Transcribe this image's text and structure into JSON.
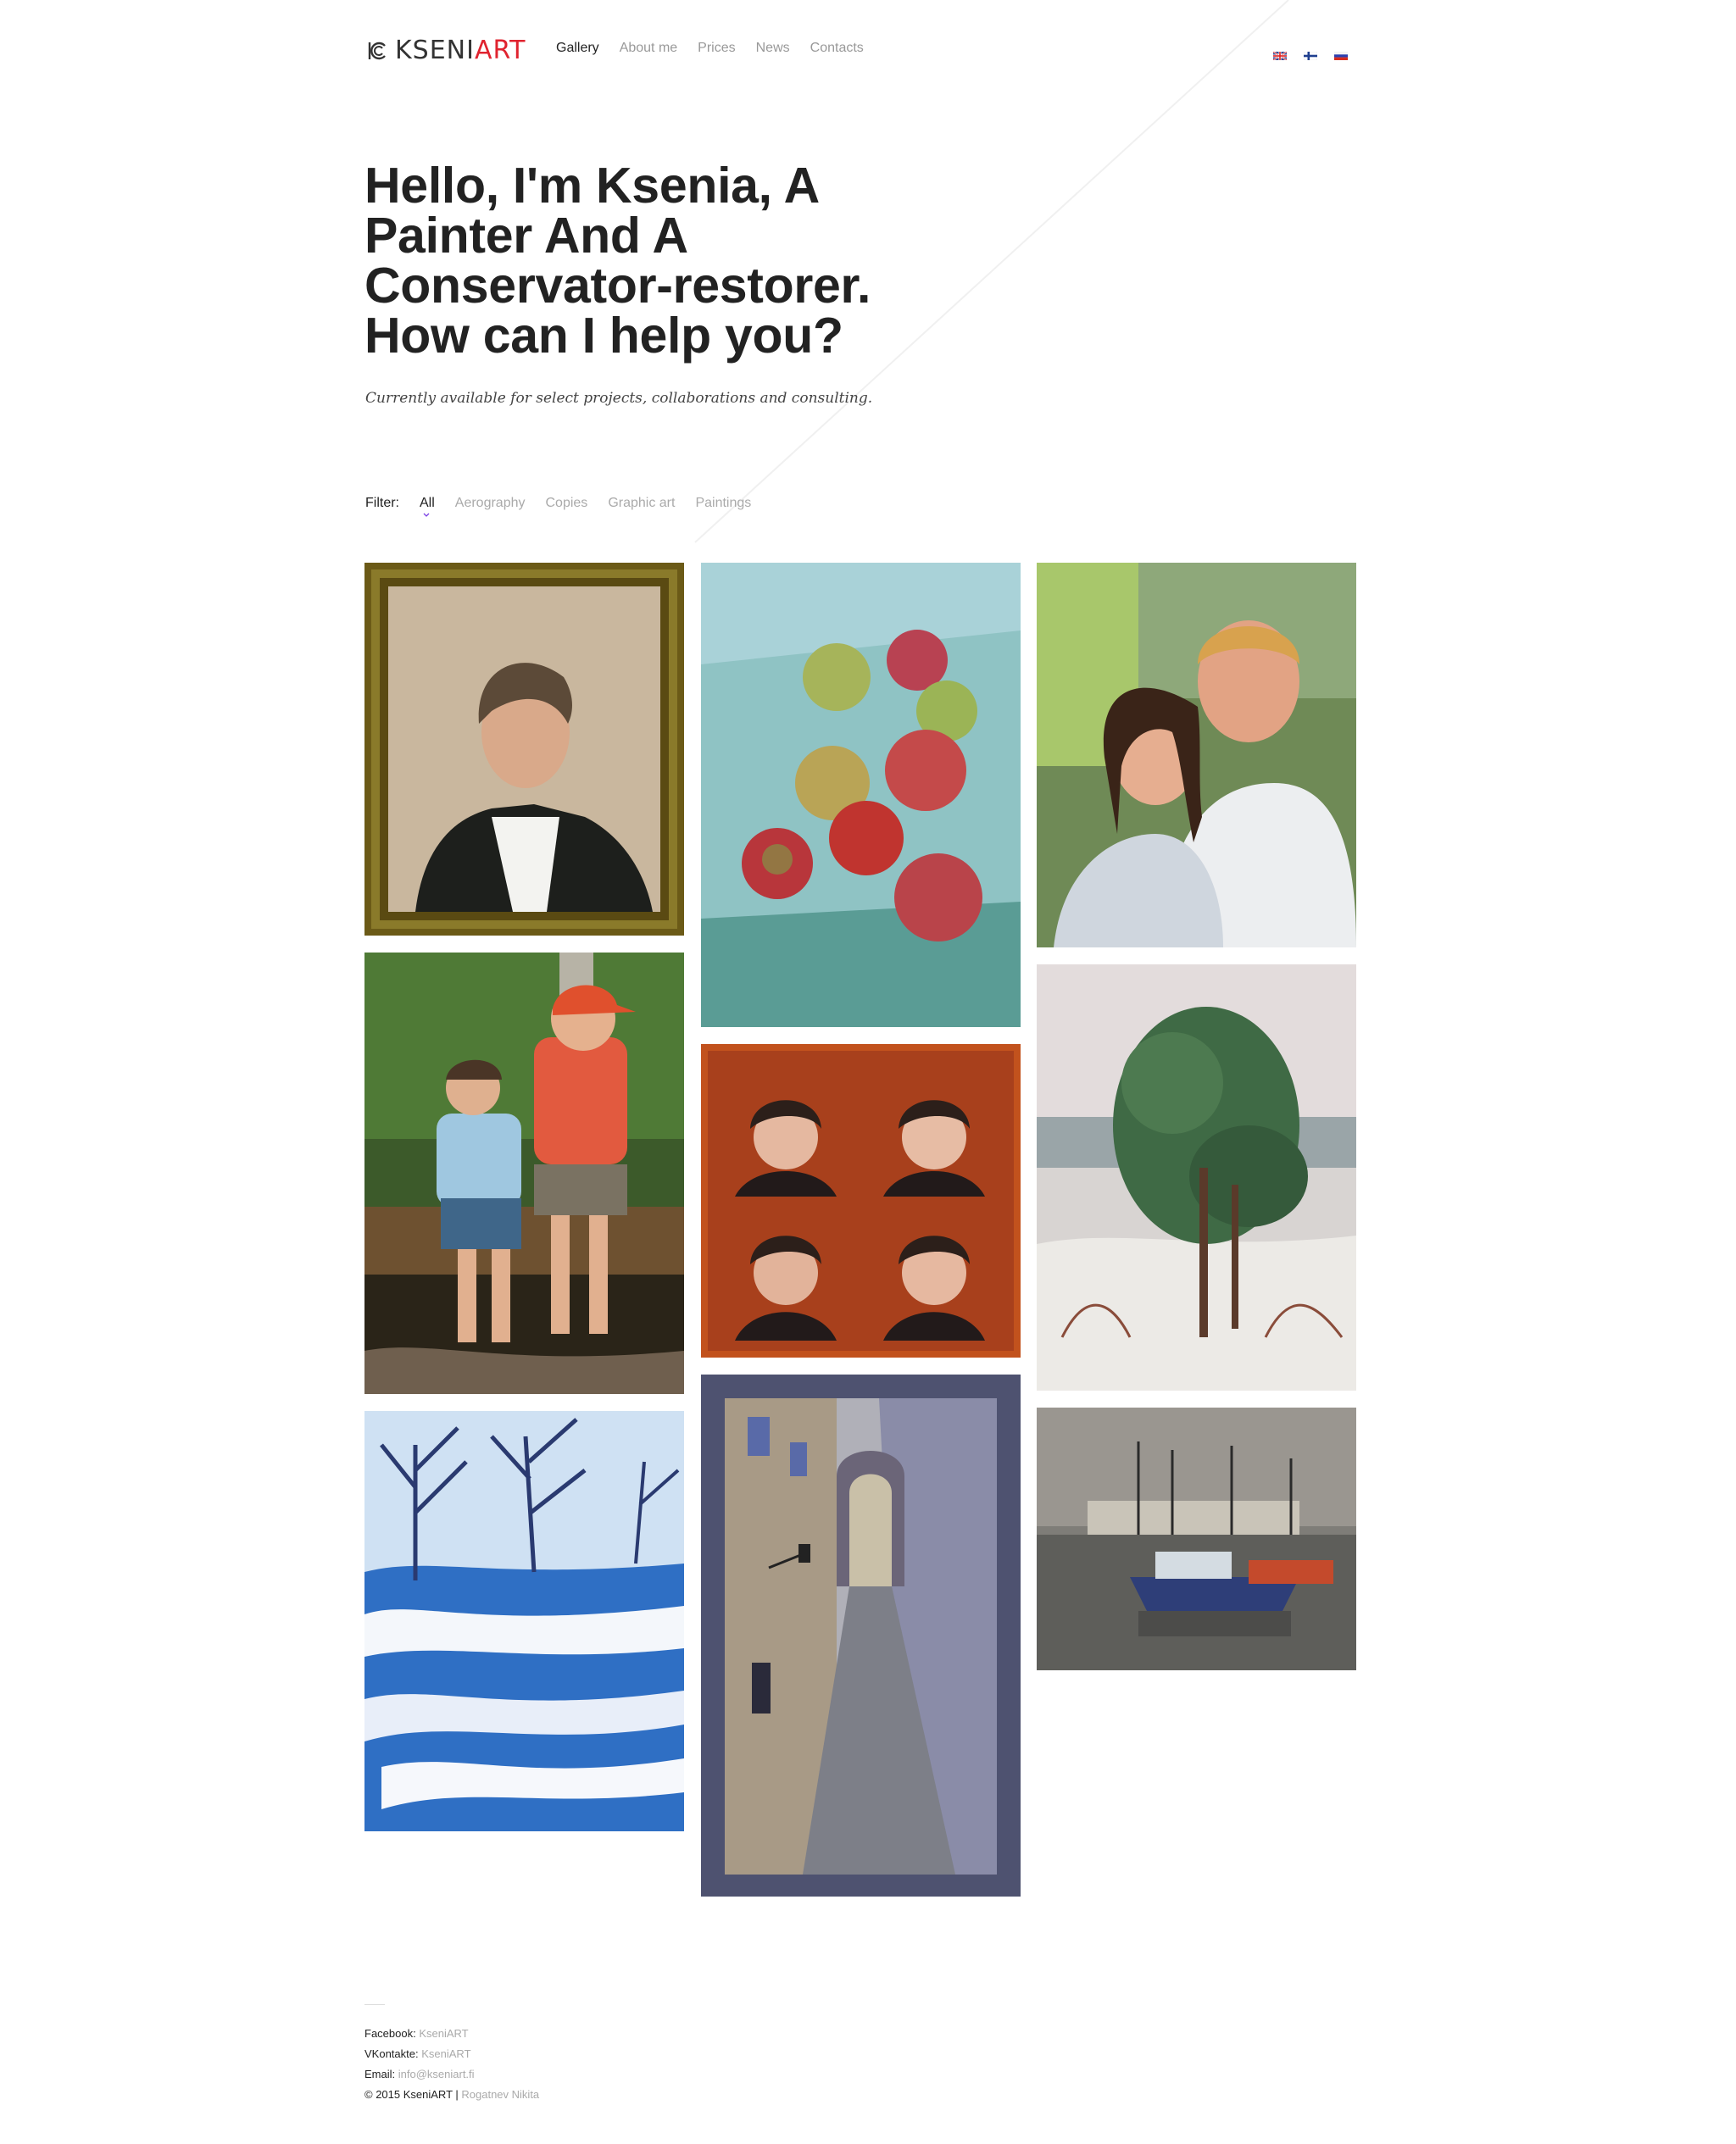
{
  "brand": {
    "logo_main": "KSENI",
    "logo_accent": "ART"
  },
  "nav": [
    {
      "label": "Gallery",
      "active": true
    },
    {
      "label": "About me"
    },
    {
      "label": "Prices"
    },
    {
      "label": "News"
    },
    {
      "label": "Contacts"
    }
  ],
  "languages": [
    "English",
    "Finnish",
    "Russian"
  ],
  "hero": {
    "title": "Hello, I'm Ksenia, A Painter And A Conservator-restorer. How can I help you?",
    "subtitle": "Currently available for select projects, collaborations and consulting."
  },
  "filter": {
    "label": "Filter:",
    "items": [
      "All",
      "Aerography",
      "Copies",
      "Graphic art",
      "Paintings"
    ],
    "active": "All"
  },
  "gallery": [
    {
      "subject": "framed portrait of a man in dark jacket"
    },
    {
      "subject": "apples still life"
    },
    {
      "subject": "portrait of a couple"
    },
    {
      "subject": "two boys on a pier"
    },
    {
      "subject": "four portraits of a woman"
    },
    {
      "subject": "pine tree in winter"
    },
    {
      "subject": "snowy winter landscape"
    },
    {
      "subject": "narrow old town street"
    },
    {
      "subject": "boats in harbor"
    }
  ],
  "footer": {
    "facebook_label": "Facebook:",
    "facebook_value": "KseniART",
    "vk_label": "VKontakte:",
    "vk_value": "KseniART",
    "email_label": "Email:",
    "email_value": "info@kseniart.fi",
    "copyright": "© 2015 KseniART |",
    "author": "Rogatnev Nikita"
  },
  "colors": {
    "accent": "#e0232f",
    "text": "#222222",
    "muted": "#aaaaaa",
    "filter_marker": "#7b3fe4"
  }
}
